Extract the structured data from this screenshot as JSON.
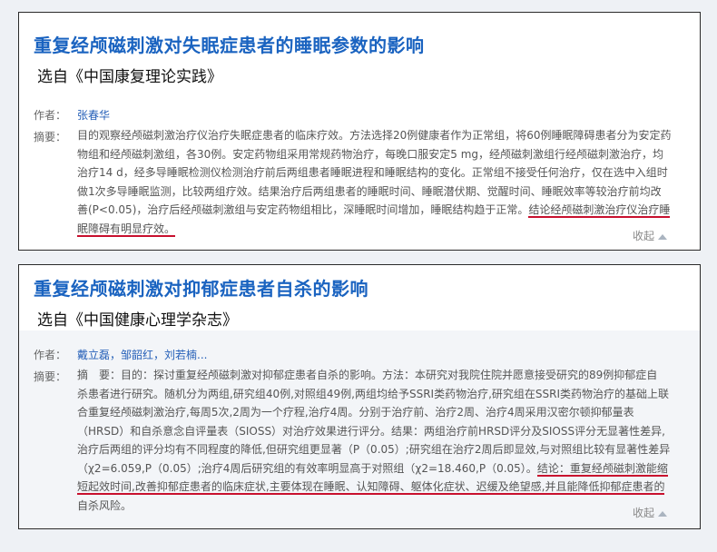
{
  "card1": {
    "title": "重复经颅磁刺激对失眠症患者的睡眠参数的影响",
    "source": "选自《中国康复理论实践》",
    "author_label": "作者：",
    "authors": "张春华",
    "abstract_label": "摘要：",
    "abstract_lines": [
      "目的观察经颅磁刺激治疗仪治疗失眠症患者的临床疗效。方法选择20例健康者作为正常组，将60例睡眠障碍患者分为安定药",
      "物组和经颅磁刺激组，各30例。安定药物组采用常规药物治疗，每晚口服安定5 mg，经颅磁刺激组行经颅磁刺激治疗，均",
      "治疗14 d，经多导睡眠检测仪检测治疗前后两组患者睡眠进程和睡眠结构的变化。正常组不接受任何治疗，仅在选中入组时",
      "做1次多导睡眠监测，比较两组疗效。结果治疗后两组患者的睡眠时间、睡眠潜伏期、觉醒时间、睡眠效率等较治疗前均改",
      "善(P<0.05)，治疗后经颅磁刺激组与安定药物组相比，深睡眠时间增加，睡眠结构趋于正常。",
      "结论经颅磁刺激治疗仪治疗睡",
      "眠障碍有明显疗效。"
    ],
    "collapse": "收起"
  },
  "card2": {
    "title": "重复经颅磁刺激对抑郁症患者自杀的影响",
    "source": "选自《中国健康心理学杂志》",
    "author_label": "作者：",
    "authors": "戴立磊，邹韶红，刘若楠...",
    "abstract_label": "摘要：",
    "abstract_lines": [
      "摘　要：目的：探讨重复经颅磁刺激对抑郁症患者自杀的影响。方法：本研究对我院住院并愿意接受研究的89例抑郁症自",
      "杀患者进行研究。随机分为两组,研究组40例,对照组49例,两组均给予SSRI类药物治疗,研究组在SSRI类药物治疗的基础上联",
      "合重复经颅磁刺激治疗,每周5次,2周为一个疗程,治疗4周。分别于治疗前、治疗2周、治疗4周采用汉密尔顿抑郁量表",
      "（HRSD）和自杀意念自评量表（SIOSS）对治疗效果进行评分。结果：两组治疗前HRSD评分及SIOSS评分无显著性差异,",
      "治疗后两组的评分均有不同程度的降低,但研究组更显著（P（0.05）;研究组在治疗2周后即显效,与对照组比较有显著性差异",
      "（χ2=6.059,P（0.05）;治疗4周后研究组的有效率明显高于对照组（χ2=18.460,P（0.05）。",
      "结论：重复经颅磁刺激能缩",
      "短起效时间,改善抑郁症患者的临床症状,主要体现在睡眠、认知障碍、躯体化症状、迟缓及绝望感,并且能降低抑郁症患者的",
      "自杀风险。"
    ],
    "collapse": "收起"
  }
}
